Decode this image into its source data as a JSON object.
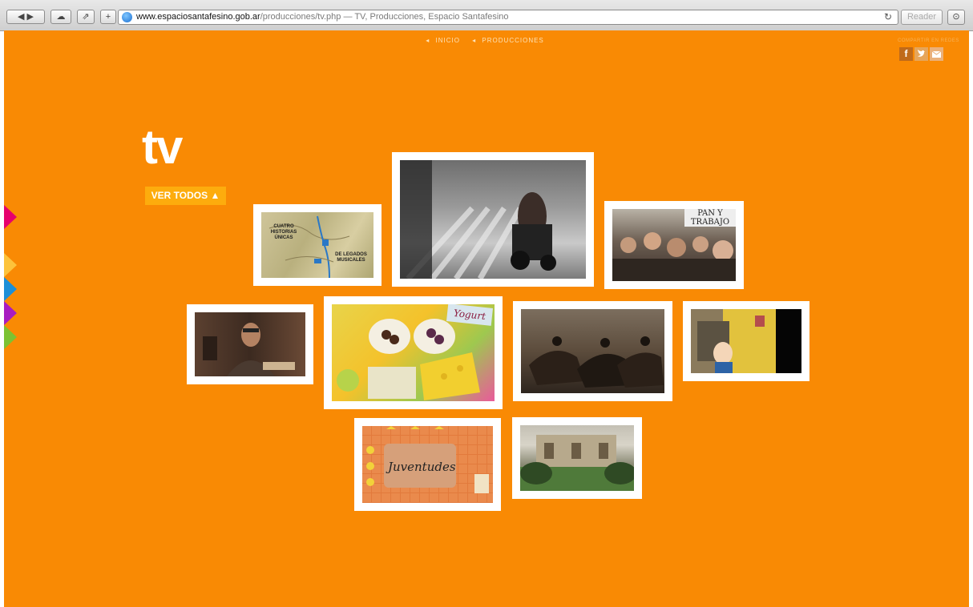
{
  "browser": {
    "url_host": "www.espaciosantafesino.gob.ar",
    "url_path": "/producciones/tv.php",
    "url_title": " — TV, Producciones, Espacio Santafesino",
    "reader_label": "Reader"
  },
  "breadcrumb": {
    "items": [
      "INICIO",
      "PRODUCCIONES"
    ]
  },
  "share": {
    "label": "COMPARTIR EN REDES"
  },
  "page": {
    "title": "tv",
    "ver_todos": "VER TODOS ▲"
  },
  "thumbnails": [
    {
      "name": "map-documentary",
      "caption": [
        "CUATRO HISTORIAS ÚNICAS",
        "DE LEGADOS MUSICALES"
      ]
    },
    {
      "name": "wheelchair-street"
    },
    {
      "name": "protest-crowd",
      "sign": "PAN Y TRABAJO"
    },
    {
      "name": "man-with-glasses"
    },
    {
      "name": "colorful-candy",
      "sign": "Yogurt"
    },
    {
      "name": "horse-riders"
    },
    {
      "name": "cartoon-window"
    },
    {
      "name": "juventudes",
      "sign": "Juventudes"
    },
    {
      "name": "garden-house"
    }
  ],
  "colors": {
    "background": "#f98a04",
    "accent": "#fdac0d"
  },
  "side_tabs": [
    "#e6006d",
    "#fdc33b",
    "#1c8fd8",
    "#a81cc1",
    "#7cc232"
  ]
}
